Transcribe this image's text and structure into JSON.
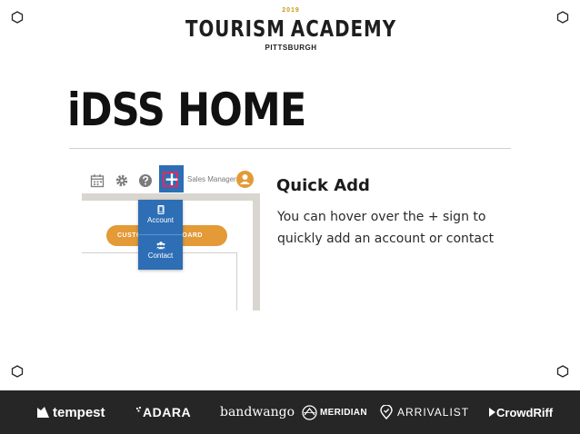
{
  "logo": {
    "year": "2019",
    "left_word": "TOURISM",
    "right_word": "ACADEMY",
    "city": "PITTSBURGH"
  },
  "slide": {
    "title": "iDSS HOME",
    "heading": "Quick Add",
    "body": "You can hover over the + sign to quickly add an account or contact"
  },
  "app": {
    "role_label": "Sales Manager",
    "quick_add_symbol": "+",
    "dashboard_button_left": "CUSTO",
    "dashboard_button_right": "ASHBOARD",
    "dropdown_items": [
      {
        "label": "Account",
        "icon": "tablet-icon"
      },
      {
        "label": "Contact",
        "icon": "users-icon"
      }
    ],
    "accent_blue": "#2d6eb5",
    "accent_orange": "#e39a37"
  },
  "sponsors": [
    "tempest",
    "ADARA",
    "bandwango",
    "MERIDIAN",
    "ARRIVALIST",
    "CrowdRiff"
  ]
}
